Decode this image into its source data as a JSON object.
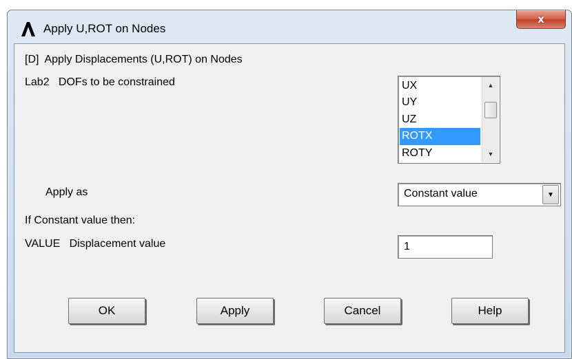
{
  "window": {
    "title": "Apply U,ROT on Nodes",
    "close_label": "x",
    "logo_icon": "ansys-logo-icon",
    "close_color": "#c2412a"
  },
  "header": "[D]  Apply Displacements (U,ROT) on Nodes",
  "dofs": {
    "label": "Lab2   DOFs to be constrained",
    "items": [
      "UX",
      "UY",
      "UZ",
      "ROTX",
      "ROTY"
    ],
    "selected": "ROTX",
    "selected_color": "#3399ff"
  },
  "apply_as": {
    "label": "Apply as",
    "value": "Constant value"
  },
  "constant_label": "If Constant value then:",
  "value_field": {
    "label": "VALUE   Displacement value",
    "value": "1"
  },
  "buttons": {
    "ok": "OK",
    "apply": "Apply",
    "cancel": "Cancel",
    "help": "Help"
  }
}
